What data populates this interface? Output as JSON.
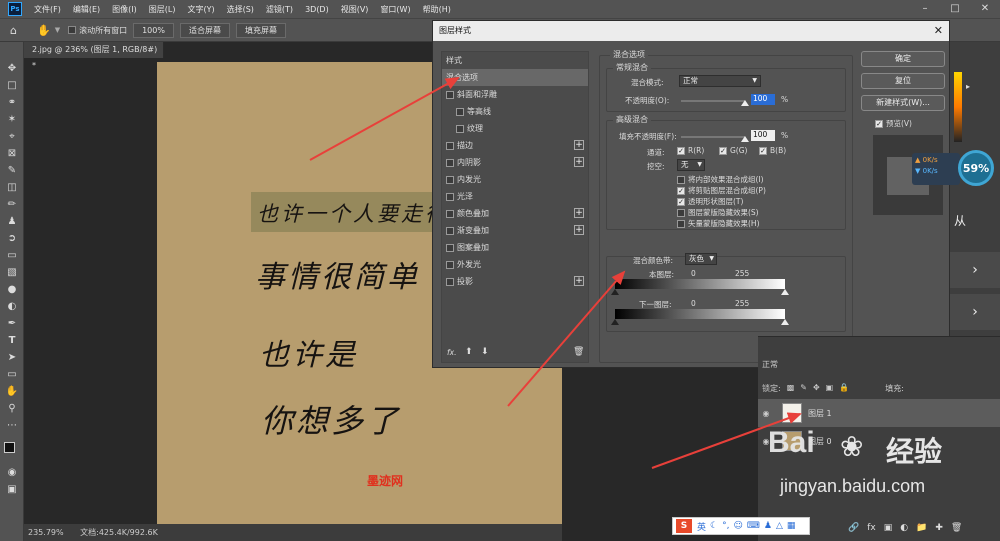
{
  "app": {
    "logo": "Ps",
    "menu": [
      "文件(F)",
      "编辑(E)",
      "图像(I)",
      "图层(L)",
      "文字(Y)",
      "选择(S)",
      "滤镜(T)",
      "3D(D)",
      "视图(V)",
      "窗口(W)",
      "帮助(H)"
    ]
  },
  "options": {
    "scroll_all": "滚动所有窗口",
    "zoom": "100%",
    "fit_screen": "适合屏幕",
    "fill_screen": "填充屏幕"
  },
  "document": {
    "tab": "2.jpg @ 236% (图层 1, RGB/8#) *",
    "status_zoom": "235.79%",
    "status_doc": "文档:425.4K/992.6K",
    "lines": [
      "也许一个人要走很多",
      "事情很简单",
      "也许是",
      "你想多了"
    ],
    "stamp": "墨迹网"
  },
  "dialog": {
    "title": "图层样式",
    "styles": [
      {
        "label": "样式",
        "check": false,
        "plus": false
      },
      {
        "label": "混合选项",
        "check": false,
        "plus": false,
        "selected": true
      },
      {
        "label": "斜面和浮雕",
        "check": true,
        "plus": false
      },
      {
        "label": "等高线",
        "check": true,
        "plus": false,
        "indent": true
      },
      {
        "label": "纹理",
        "check": true,
        "plus": false,
        "indent": true
      },
      {
        "label": "描边",
        "check": true,
        "plus": true
      },
      {
        "label": "内阴影",
        "check": true,
        "plus": true
      },
      {
        "label": "内发光",
        "check": true,
        "plus": false
      },
      {
        "label": "光泽",
        "check": true,
        "plus": false
      },
      {
        "label": "颜色叠加",
        "check": true,
        "plus": true
      },
      {
        "label": "渐变叠加",
        "check": true,
        "plus": true
      },
      {
        "label": "图案叠加",
        "check": true,
        "plus": false
      },
      {
        "label": "外发光",
        "check": true,
        "plus": false
      },
      {
        "label": "投影",
        "check": true,
        "plus": true
      }
    ],
    "fx_label": "fx.",
    "blend": {
      "section": "混合选项",
      "general": "常规混合",
      "mode_label": "混合模式:",
      "mode_value": "正常",
      "opacity_label": "不透明度(O):",
      "opacity_value": "100",
      "advanced": "高级混合",
      "fill_label": "填充不透明度(F):",
      "fill_value": "100",
      "percent": "%",
      "channels_label": "通道:",
      "channels": [
        "R(R)",
        "G(G)",
        "B(B)"
      ],
      "knockout_label": "挖空:",
      "knockout_value": "无",
      "options": [
        {
          "label": "将内部效果混合成组(I)",
          "checked": false
        },
        {
          "label": "将剪贴图层混合成组(P)",
          "checked": true
        },
        {
          "label": "透明形状图层(T)",
          "checked": true
        },
        {
          "label": "图层蒙版隐藏效果(S)",
          "checked": false
        },
        {
          "label": "矢量蒙版隐藏效果(H)",
          "checked": false
        }
      ],
      "blend_if_label": "混合颜色带:",
      "blend_if_value": "灰色",
      "this_layer": "本图层:",
      "underlying": "下一图层:",
      "range_min": "0",
      "range_max": "255"
    },
    "buttons": {
      "ok": "确定",
      "reset": "复位",
      "new_style": "新建样式(W)...",
      "preview": "预览(V)"
    }
  },
  "layers": {
    "mode": "正常",
    "lock_label": "锁定:",
    "fill_label": "填充:",
    "items": [
      {
        "name": "图层 1",
        "active": true
      },
      {
        "name": "图层 0",
        "active": false
      }
    ]
  },
  "speed": {
    "percent": "59%",
    "up": "0K/s",
    "down": "0K/s"
  },
  "right_text": "从",
  "ime": {
    "label": "英"
  },
  "watermark": {
    "brand": "Bai",
    "cn": "经验",
    "url": "jingyan.baidu.com"
  },
  "colors": {
    "accent": "#31a8ff",
    "arrow": "#e8403a",
    "selection": "#2a6dd6"
  }
}
